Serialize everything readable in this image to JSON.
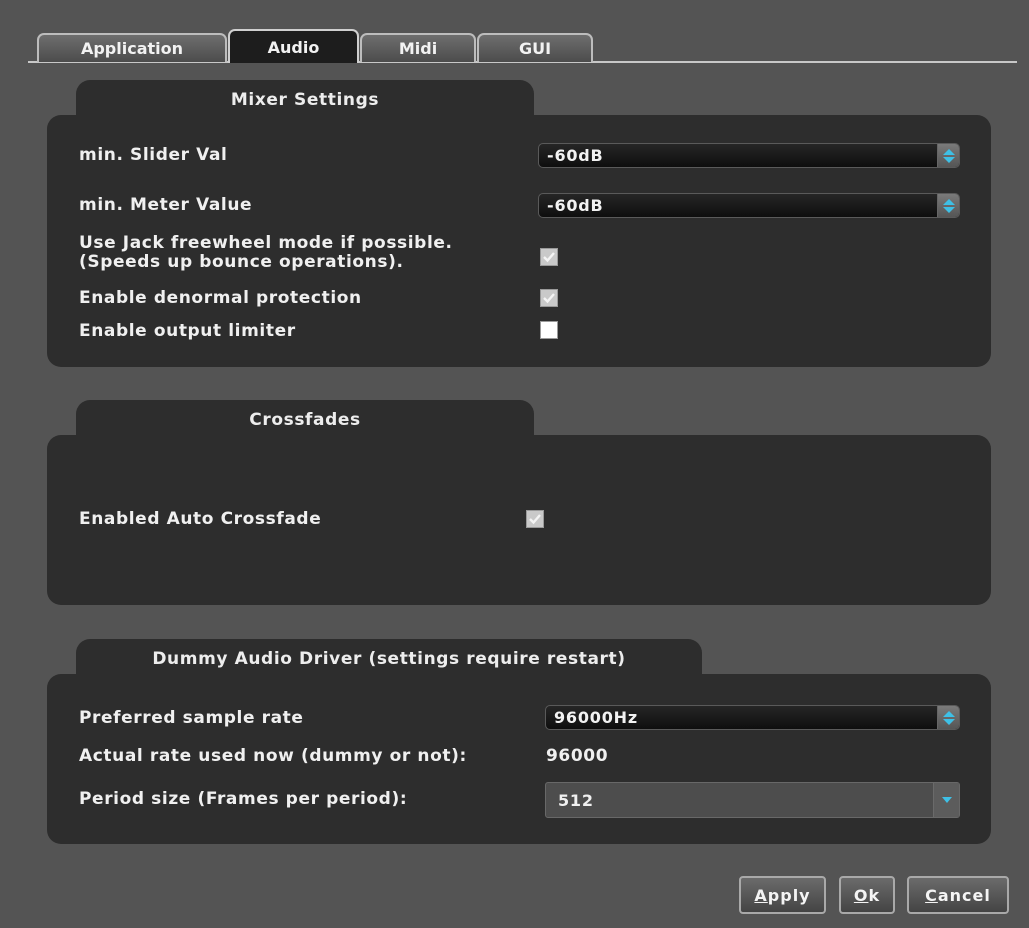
{
  "tabs": [
    {
      "label": "Application",
      "active": false
    },
    {
      "label": "Audio",
      "active": true
    },
    {
      "label": "Midi",
      "active": false
    },
    {
      "label": "GUI",
      "active": false
    }
  ],
  "mixer": {
    "title": "Mixer Settings",
    "min_slider_label": "min. Slider Val",
    "min_slider_value": "-60dB",
    "min_meter_label": "min. Meter Value",
    "min_meter_value": "-60dB",
    "freewheel_label_line1": "Use Jack freewheel mode if possible.",
    "freewheel_label_line2": "(Speeds up bounce operations).",
    "freewheel_checked": true,
    "denormal_label": "Enable denormal protection",
    "denormal_checked": true,
    "limiter_label": "Enable output limiter",
    "limiter_checked": false
  },
  "crossfades": {
    "title": "Crossfades",
    "auto_label": "Enabled Auto Crossfade",
    "auto_checked": true
  },
  "dummy": {
    "title": "Dummy Audio Driver (settings require restart)",
    "sample_rate_label": "Preferred sample rate",
    "sample_rate_value": "96000Hz",
    "actual_rate_label": "Actual rate used now (dummy or not):",
    "actual_rate_value": "96000",
    "period_label": "Period size (Frames per period):",
    "period_value": "512"
  },
  "buttons": {
    "apply_mnemonic": "A",
    "apply_rest": "pply",
    "ok_mnemonic": "O",
    "ok_rest": "k",
    "cancel_mnemonic": "C",
    "cancel_rest": "ancel"
  },
  "colors": {
    "accent": "#3ec0e6",
    "background": "#545454",
    "panel": "#2d2d2d"
  }
}
